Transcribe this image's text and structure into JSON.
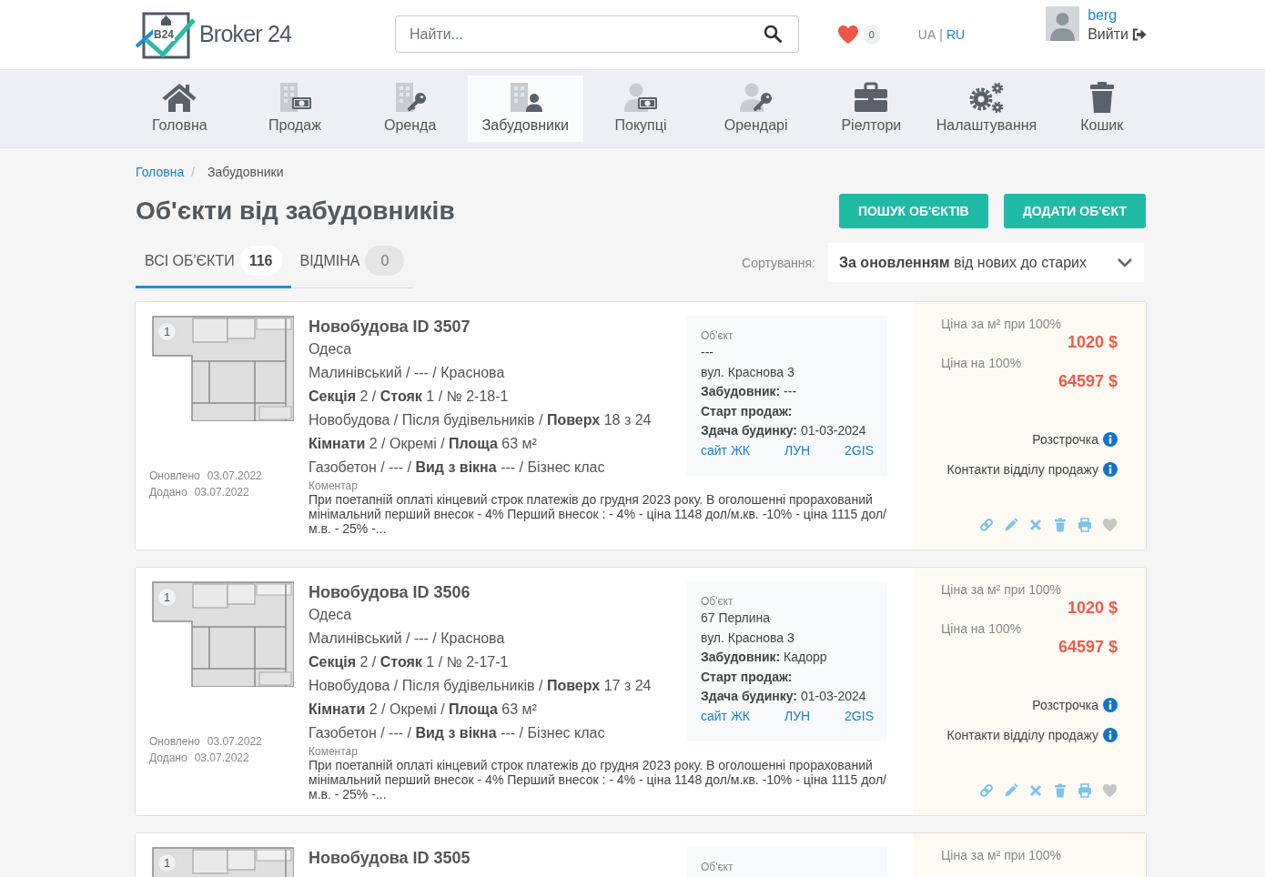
{
  "header": {
    "logo": {
      "mark": "B24",
      "text": "Broker 24"
    },
    "search": {
      "placeholder": "Найти..."
    },
    "favorites_count": "0",
    "languages": [
      {
        "label": "UA",
        "selected": true
      },
      {
        "label": "RU",
        "selected": false
      }
    ],
    "language_separator": "|",
    "user": {
      "name": "berg",
      "logout": "Вийти"
    }
  },
  "nav": [
    {
      "kind": "home",
      "label": "Головна",
      "selected": false
    },
    {
      "kind": "sale",
      "label": "Продаж",
      "selected": false
    },
    {
      "kind": "rent",
      "label": "Оренда",
      "selected": false
    },
    {
      "kind": "developers",
      "label": "Забудовники",
      "selected": true
    },
    {
      "kind": "buyers",
      "label": "Покупці",
      "selected": false
    },
    {
      "kind": "tenants",
      "label": "Орендарі",
      "selected": false
    },
    {
      "kind": "realtors",
      "label": "Ріелтори",
      "selected": false
    },
    {
      "kind": "settings",
      "label": "Налаштування",
      "selected": false
    },
    {
      "kind": "trash",
      "label": "Кошик",
      "selected": false
    }
  ],
  "breadcrumb": {
    "items": [
      "Головна",
      "Забудовники"
    ],
    "separator": "/"
  },
  "page_title": "Об'єкти від забудовників",
  "buttons": [
    "ПОШУК ОБ'ЄКТІВ",
    "ДОДАТИ ОБ'ЄКТ"
  ],
  "tabs": [
    {
      "label": "ВСІ ОБ'ЄКТИ",
      "count": "116",
      "selected": true
    },
    {
      "label": "ВІДМІНА",
      "count": "0",
      "selected": false
    }
  ],
  "sort": {
    "label": "Сортування:",
    "value": "**За оновленням** від нових до старих"
  },
  "listings": [
    {
      "photo_count": "1",
      "dates": [
        {
          "label": "Оновлено",
          "value": "03.07.2022"
        },
        {
          "label": "Додано",
          "value": "03.07.2022"
        }
      ],
      "title": "Новобудова ID 3507",
      "city": "Одеса",
      "details": [
        "Малинівський / --- / Краснова",
        "**Секція** 2 / **Стояк** 1 / № 2-18-1",
        "Новобудова / Після будівельників / **Поверх** 18 з 24",
        "**Кімнати** 2 / Окремі / **Площа** 63 м²",
        "Газобетон / --- / **Вид з вікна** --- / Бізнес клас"
      ],
      "comment_label": "Коментар",
      "comment": "При поетапній оплаті кінцевий строк платежів до грудня 2023 року. В оголошенні прорахований мінімальний перший внесок - 4% Перший внесок : - 4% - ціна 1148 дол/м.кв. -10% - ціна 1115 дол/м.в. - 25% -...",
      "object": {
        "heading": "Об'єкт",
        "lines": [
          "---",
          "вул. Краснова 3",
          "**Забудовник:** ---",
          "**Старт продаж:**",
          "**Здача будинку:** 01-03-2024"
        ],
        "links": [
          "сайт ЖК",
          "ЛУН",
          "2GIS"
        ]
      },
      "prices": [
        {
          "label": "Ціна за м² при 100%",
          "value": "1020 $"
        },
        {
          "label": "Ціна на 100%",
          "value": "64597 $"
        }
      ],
      "info": [
        "Розстрочка",
        "Контакти відділу продажу"
      ],
      "favorite": false
    },
    {
      "photo_count": "1",
      "dates": [
        {
          "label": "Оновлено",
          "value": "03.07.2022"
        },
        {
          "label": "Додано",
          "value": "03.07.2022"
        }
      ],
      "title": "Новобудова ID 3506",
      "city": "Одеса",
      "details": [
        "Малинівський / --- / Краснова",
        "**Секція** 2 / **Стояк** 1 / № 2-17-1",
        "Новобудова / Після будівельників / **Поверх** 17 з 24",
        "**Кімнати** 2 / Окремі / **Площа** 63 м²",
        "Газобетон / --- / **Вид з вікна** --- / Бізнес клас"
      ],
      "comment_label": "Коментар",
      "comment": "При поетапній оплаті кінцевий строк платежів до грудня 2023 року. В оголошенні прорахований мінімальний перший внесок - 4% Перший внесок : - 4% - ціна 1148 дол/м.кв. -10% - ціна 1115 дол/м.в. - 25% -...",
      "object": {
        "heading": "Об'єкт",
        "lines": [
          "67 Перлина",
          "вул. Краснова 3",
          "**Забудовник:** Кадорр",
          "**Старт продаж:**",
          "**Здача будинку:** 01-03-2024"
        ],
        "links": [
          "сайт ЖК",
          "ЛУН",
          "2GIS"
        ]
      },
      "prices": [
        {
          "label": "Ціна за м² при 100%",
          "value": "1020 $"
        },
        {
          "label": "Ціна на 100%",
          "value": "64597 $"
        }
      ],
      "info": [
        "Розстрочка",
        "Контакти відділу продажу"
      ],
      "favorite": false
    },
    {
      "photo_count": "1",
      "title": "Новобудова ID 3505",
      "object": {
        "heading": "Об'єкт"
      },
      "prices": [
        {
          "label": "Ціна за м² при 100%"
        }
      ]
    }
  ]
}
